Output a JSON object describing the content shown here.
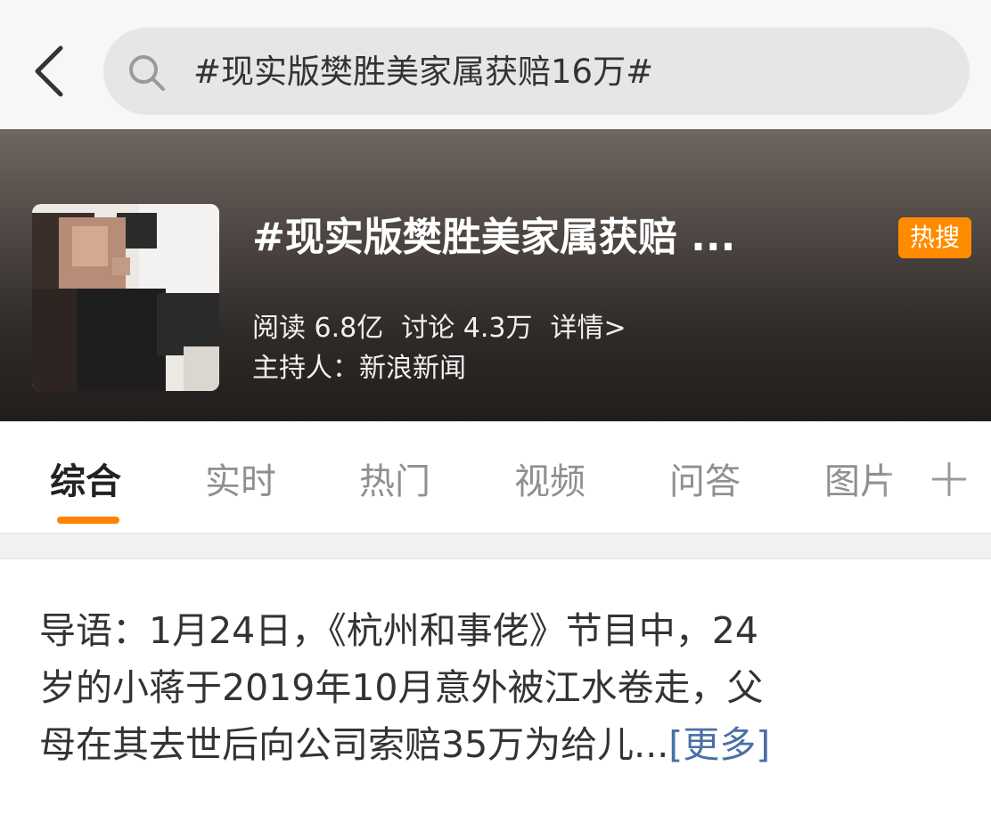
{
  "search": {
    "query": "#现实版樊胜美家属获赔16万#"
  },
  "topic": {
    "title": "#现实版樊胜美家属获赔 ...",
    "badge": "热搜",
    "reads": "阅读 6.8亿",
    "discussions": "讨论 4.3万",
    "details": "详情>",
    "host": "主持人：新浪新闻"
  },
  "tabs": [
    {
      "label": "综合"
    },
    {
      "label": "实时"
    },
    {
      "label": "热门"
    },
    {
      "label": "视频"
    },
    {
      "label": "问答"
    },
    {
      "label": "图片"
    }
  ],
  "intro": {
    "line1": "导语：1月24日，《杭州和事佬》节目中，24",
    "line2": "岁的小蒋于2019年10月意外被江水卷走，父",
    "line3": "母在其去世后向公司索赔35万为给儿...",
    "more": "[更多]"
  },
  "colors": {
    "accent": "#ff8200",
    "badge": "#ff8c00",
    "link": "#4a6fa5"
  },
  "icons": [
    "back-arrow-icon",
    "search-icon",
    "plus-icon"
  ]
}
